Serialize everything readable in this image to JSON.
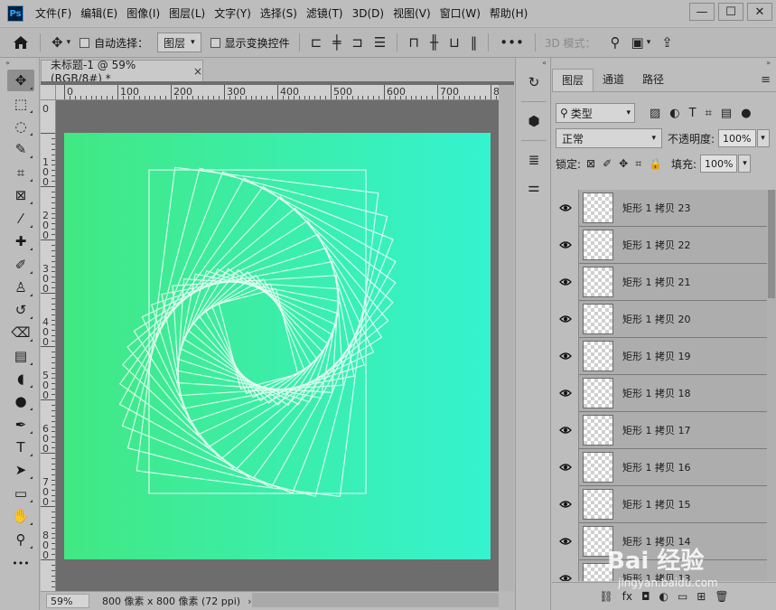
{
  "app": {
    "logo": "Ps"
  },
  "menu": [
    "文件(F)",
    "编辑(E)",
    "图像(I)",
    "图层(L)",
    "文字(Y)",
    "选择(S)",
    "滤镜(T)",
    "3D(D)",
    "视图(V)",
    "窗口(W)",
    "帮助(H)"
  ],
  "window_controls": {
    "minimize": "—",
    "restore": "☐",
    "close": "✕"
  },
  "options": {
    "auto_select_label": "自动选择：",
    "auto_select_value": "图层",
    "show_transform_label": "显示变换控件",
    "mode_3d_label": "3D 模式：",
    "more": "•••"
  },
  "document": {
    "tab_title": "未标题-1 @ 59%(RGB/8#) *",
    "tab_close": "×",
    "zoom": "59%",
    "info": "800 像素 x 800 像素 (72 ppi)",
    "status_arrow": "›",
    "ruler_top": [
      "0",
      "100",
      "200",
      "300",
      "400",
      "500",
      "600",
      "700",
      "8"
    ],
    "ruler_left": [
      "0",
      "1 0 0",
      "2 0 0",
      "3 0 0",
      "4 0 0",
      "5 0 0",
      "6 0 0",
      "7 0 0",
      "8 0 0"
    ],
    "gradient_start": "#41e882",
    "gradient_end": "#35f3d0",
    "spiral_stroke": "#e8fff4",
    "spiral_rects": 24,
    "spiral_rotation_step_deg": 7.2,
    "spiral_scale_step": 0.945
  },
  "tools": [
    {
      "name": "move-tool",
      "glyph": "✥",
      "active": true
    },
    {
      "name": "marquee-tool",
      "glyph": "⬚"
    },
    {
      "name": "lasso-tool",
      "glyph": "◌"
    },
    {
      "name": "quick-select-tool",
      "glyph": "✎"
    },
    {
      "name": "crop-tool",
      "glyph": "⌗"
    },
    {
      "name": "frame-tool",
      "glyph": "⊠"
    },
    {
      "name": "eyedropper-tool",
      "glyph": "⁄"
    },
    {
      "name": "healing-tool",
      "glyph": "✚"
    },
    {
      "name": "brush-tool",
      "glyph": "✐"
    },
    {
      "name": "stamp-tool",
      "glyph": "♙"
    },
    {
      "name": "history-brush-tool",
      "glyph": "↺"
    },
    {
      "name": "eraser-tool",
      "glyph": "⌫"
    },
    {
      "name": "gradient-tool",
      "glyph": "▤"
    },
    {
      "name": "blur-tool",
      "glyph": "◖"
    },
    {
      "name": "dodge-tool",
      "glyph": "●"
    },
    {
      "name": "pen-tool",
      "glyph": "✒"
    },
    {
      "name": "type-tool",
      "glyph": "T"
    },
    {
      "name": "path-select-tool",
      "glyph": "➤"
    },
    {
      "name": "shape-tool",
      "glyph": "▭"
    },
    {
      "name": "hand-tool",
      "glyph": "✋"
    },
    {
      "name": "zoom-tool",
      "glyph": "⚲"
    },
    {
      "name": "more-tools",
      "glyph": "•••"
    }
  ],
  "layers_panel": {
    "tabs": [
      "图层",
      "通道",
      "路径"
    ],
    "active_tab": 0,
    "filter_kind": "类型",
    "blend_mode": "正常",
    "opacity_label": "不透明度:",
    "opacity_value": "100%",
    "lock_label": "锁定:",
    "fill_label": "填充:",
    "fill_value": "100%",
    "layers": [
      "矩形 1 拷贝 23",
      "矩形 1 拷贝 22",
      "矩形 1 拷贝 21",
      "矩形 1 拷贝 20",
      "矩形 1 拷贝 19",
      "矩形 1 拷贝 18",
      "矩形 1 拷贝 17",
      "矩形 1 拷贝 16",
      "矩形 1 拷贝 15",
      "矩形 1 拷贝 14",
      "矩形 1 拷贝 13"
    ],
    "footer_icons": [
      "link-icon",
      "fx-icon",
      "mask-icon",
      "adjustment-icon",
      "group-icon",
      "new-layer-icon",
      "trash-icon"
    ],
    "footer_glyphs": [
      "⛓",
      "fx",
      "◘",
      "◐",
      "▭",
      "⊞",
      "🗑"
    ]
  },
  "watermark": {
    "text": "Bai 经验",
    "subtext": "jingyan.baidu.com"
  }
}
